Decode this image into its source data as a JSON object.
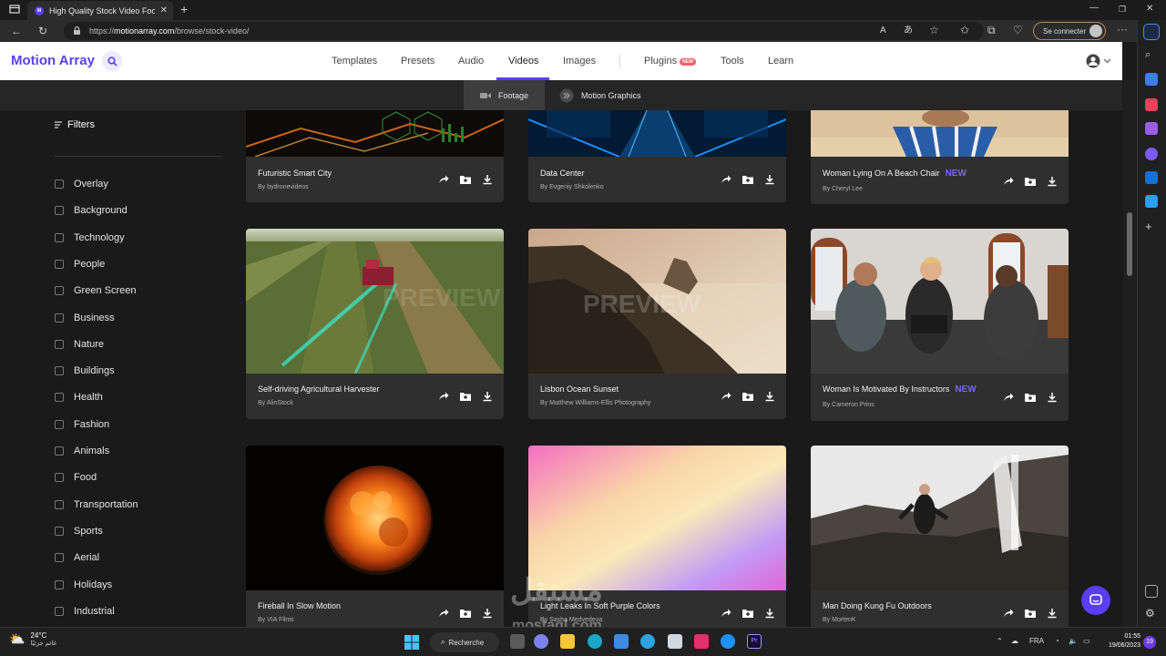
{
  "browser": {
    "tab_title": "High Quality Stock Video Footage",
    "url_prefix": "https://",
    "url_host": "motionarray.com",
    "url_path": "/browse/stock-video/",
    "signin_label": "Se connecter"
  },
  "site": {
    "logo": "Motion Array",
    "nav": [
      "Templates",
      "Presets",
      "Audio",
      "Videos",
      "Images",
      "Plugins",
      "Tools",
      "Learn"
    ],
    "nav_active": "Videos",
    "plugins_badge": "NEW",
    "subnav": [
      "Footage",
      "Motion Graphics"
    ],
    "subnav_active": "Footage"
  },
  "sidebar": {
    "title": "Filters",
    "items": [
      "Overlay",
      "Background",
      "Technology",
      "People",
      "Green Screen",
      "Business",
      "Nature",
      "Buildings",
      "Health",
      "Fashion",
      "Animals",
      "Food",
      "Transportation",
      "Sports",
      "Aerial",
      "Holidays",
      "Industrial"
    ]
  },
  "cards": [
    {
      "title": "Futuristic Smart City",
      "author": "By bydronevideos",
      "new": ""
    },
    {
      "title": "Data Center",
      "author": "By Evgeniy Shkolenko",
      "new": ""
    },
    {
      "title": "Woman Lying On A Beach Chair",
      "author": "By Cheryl Lee",
      "new": "NEW"
    },
    {
      "title": "Self-driving Agricultural Harvester",
      "author": "By AlinStock",
      "new": ""
    },
    {
      "title": "Lisbon Ocean Sunset",
      "author": "By Matthew Williams-Ellis Photography",
      "new": ""
    },
    {
      "title": "Woman Is Motivated By Instructors",
      "author": "By Cameron Prins",
      "new": "NEW"
    },
    {
      "title": "Fireball In Slow Motion",
      "author": "By VIA Films",
      "new": ""
    },
    {
      "title": "Light Leaks In Soft Purple Colors",
      "author": "By Sasha Medvedeva",
      "new": ""
    },
    {
      "title": "Man Doing Kung Fu Outdoors",
      "author": "By MortenK",
      "new": ""
    }
  ],
  "preview_watermark": "PREVIEW",
  "watermark": {
    "arabic": "مستقل",
    "latin": "mostaql.com"
  },
  "taskbar": {
    "temperature": "24°C",
    "weather_label": "غائم جزئيًا",
    "search_label": "Recherche",
    "lang": "FRA",
    "time": "01:55",
    "date": "19/06/2023",
    "notif_count": "19"
  },
  "colors": {
    "brand": "#5b3df5",
    "new_tag": "#7a63ff",
    "page_bg": "#1a1a1a",
    "card_bg": "#2f2f2f"
  }
}
